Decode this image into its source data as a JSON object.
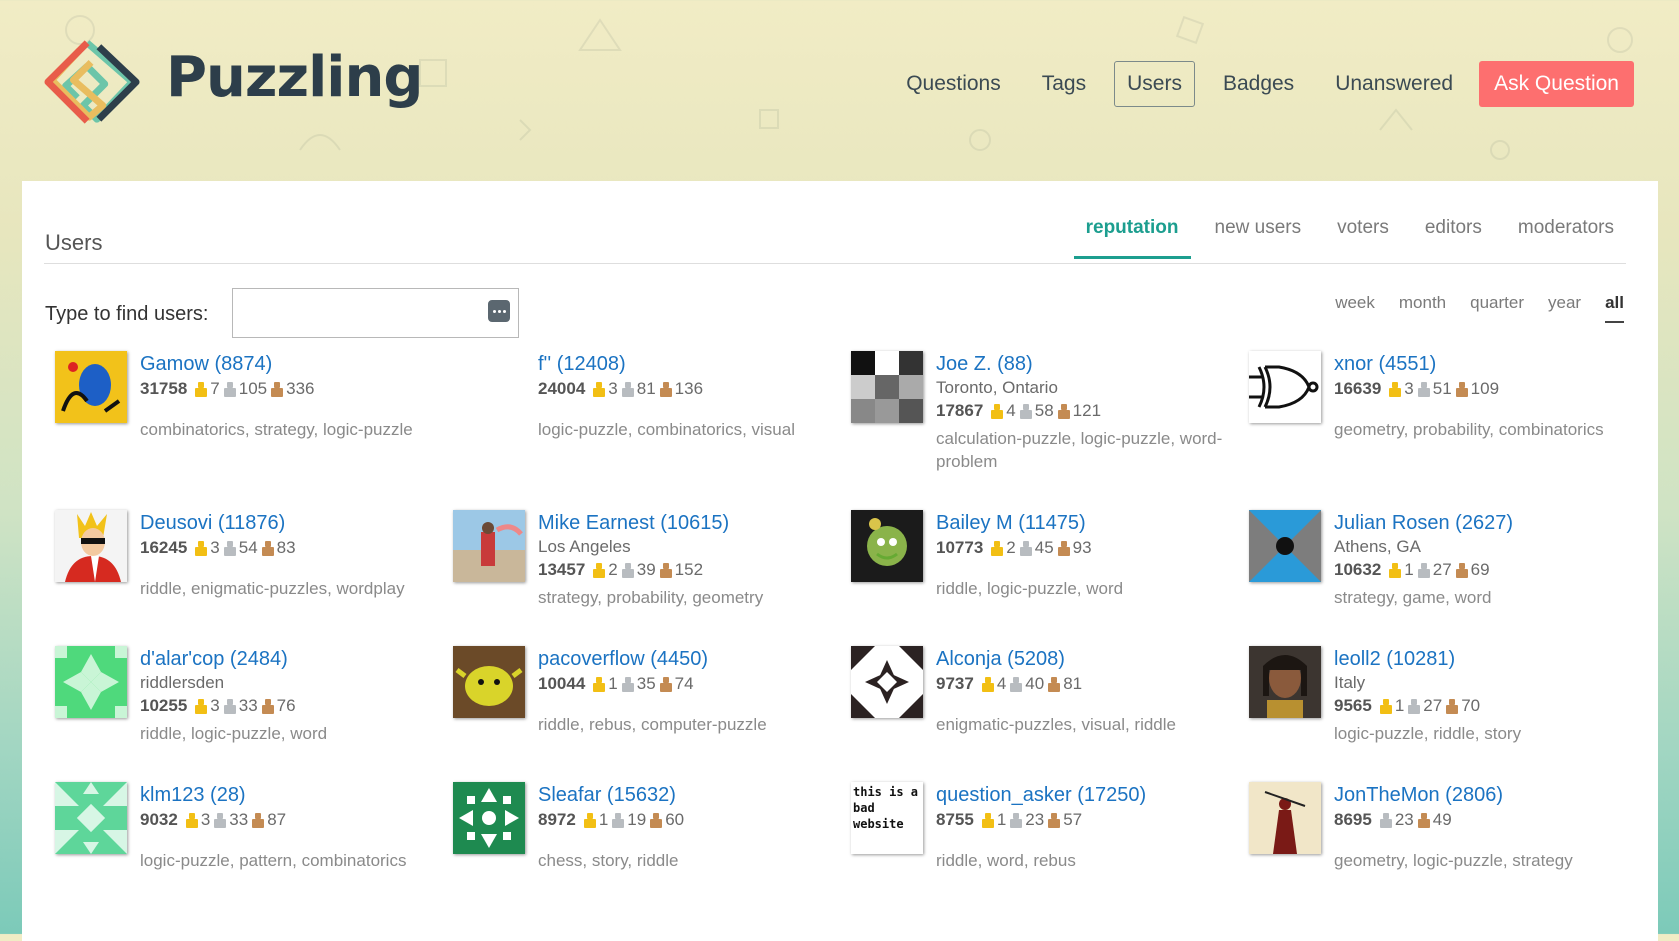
{
  "site": {
    "name": "Puzzling"
  },
  "nav": {
    "items": [
      "Questions",
      "Tags",
      "Users",
      "Badges",
      "Unanswered"
    ],
    "ask_label": "Ask Question"
  },
  "page": {
    "title": "Users",
    "tabs": [
      "reputation",
      "new users",
      "voters",
      "editors",
      "moderators"
    ],
    "find_label": "Type to find users:",
    "find_placeholder": "",
    "periods": [
      "week",
      "month",
      "quarter",
      "year",
      "all"
    ]
  },
  "users": [
    {
      "name": "Gamow (8874)",
      "location": "",
      "rep": "31758",
      "gold": "7",
      "silver": "105",
      "bronze": "336",
      "tags": "combinatorics, strategy, logic-puzzle"
    },
    {
      "name": "f'' (12408)",
      "location": "",
      "rep": "24004",
      "gold": "3",
      "silver": "81",
      "bronze": "136",
      "tags": "logic-puzzle, combinatorics, visual"
    },
    {
      "name": "Joe Z. (88)",
      "location": "Toronto, Ontario",
      "rep": "17867",
      "gold": "4",
      "silver": "58",
      "bronze": "121",
      "tags": "calculation-puzzle, logic-puzzle, word-problem"
    },
    {
      "name": "xnor (4551)",
      "location": "",
      "rep": "16639",
      "gold": "3",
      "silver": "51",
      "bronze": "109",
      "tags": "geometry, probability, combinatorics"
    },
    {
      "name": "Deusovi (11876)",
      "location": "",
      "rep": "16245",
      "gold": "3",
      "silver": "54",
      "bronze": "83",
      "tags": "riddle, enigmatic-puzzles, wordplay"
    },
    {
      "name": "Mike Earnest (10615)",
      "location": "Los Angeles",
      "rep": "13457",
      "gold": "2",
      "silver": "39",
      "bronze": "152",
      "tags": "strategy, probability, geometry"
    },
    {
      "name": "Bailey M (11475)",
      "location": "",
      "rep": "10773",
      "gold": "2",
      "silver": "45",
      "bronze": "93",
      "tags": "riddle, logic-puzzle, word"
    },
    {
      "name": "Julian Rosen (2627)",
      "location": "Athens, GA",
      "rep": "10632",
      "gold": "1",
      "silver": "27",
      "bronze": "69",
      "tags": "strategy, game, word"
    },
    {
      "name": "d'alar'cop (2484)",
      "location": "riddlersden",
      "rep": "10255",
      "gold": "3",
      "silver": "33",
      "bronze": "76",
      "tags": "riddle, logic-puzzle, word"
    },
    {
      "name": "pacoverflow (4450)",
      "location": "",
      "rep": "10044",
      "gold": "1",
      "silver": "35",
      "bronze": "74",
      "tags": "riddle, rebus, computer-puzzle"
    },
    {
      "name": "Alconja (5208)",
      "location": "",
      "rep": "9737",
      "gold": "4",
      "silver": "40",
      "bronze": "81",
      "tags": "enigmatic-puzzles, visual, riddle"
    },
    {
      "name": "leoll2 (10281)",
      "location": "Italy",
      "rep": "9565",
      "gold": "1",
      "silver": "27",
      "bronze": "70",
      "tags": "logic-puzzle, riddle, story"
    },
    {
      "name": "klm123 (28)",
      "location": "",
      "rep": "9032",
      "gold": "3",
      "silver": "33",
      "bronze": "87",
      "tags": "logic-puzzle, pattern, combinatorics"
    },
    {
      "name": "Sleafar (15632)",
      "location": "",
      "rep": "8972",
      "gold": "1",
      "silver": "19",
      "bronze": "60",
      "tags": "chess, story, riddle"
    },
    {
      "name": "question_asker (17250)",
      "location": "",
      "rep": "8755",
      "gold": "1",
      "silver": "23",
      "bronze": "57",
      "tags": "riddle, word, rebus"
    },
    {
      "name": "JonTheMon (2806)",
      "location": "",
      "rep": "8695",
      "gold": "",
      "silver": "23",
      "bronze": "49",
      "tags": "geometry, logic-puzzle, strategy"
    }
  ],
  "avatar_texts": {
    "question_asker": "this is a bad website"
  }
}
